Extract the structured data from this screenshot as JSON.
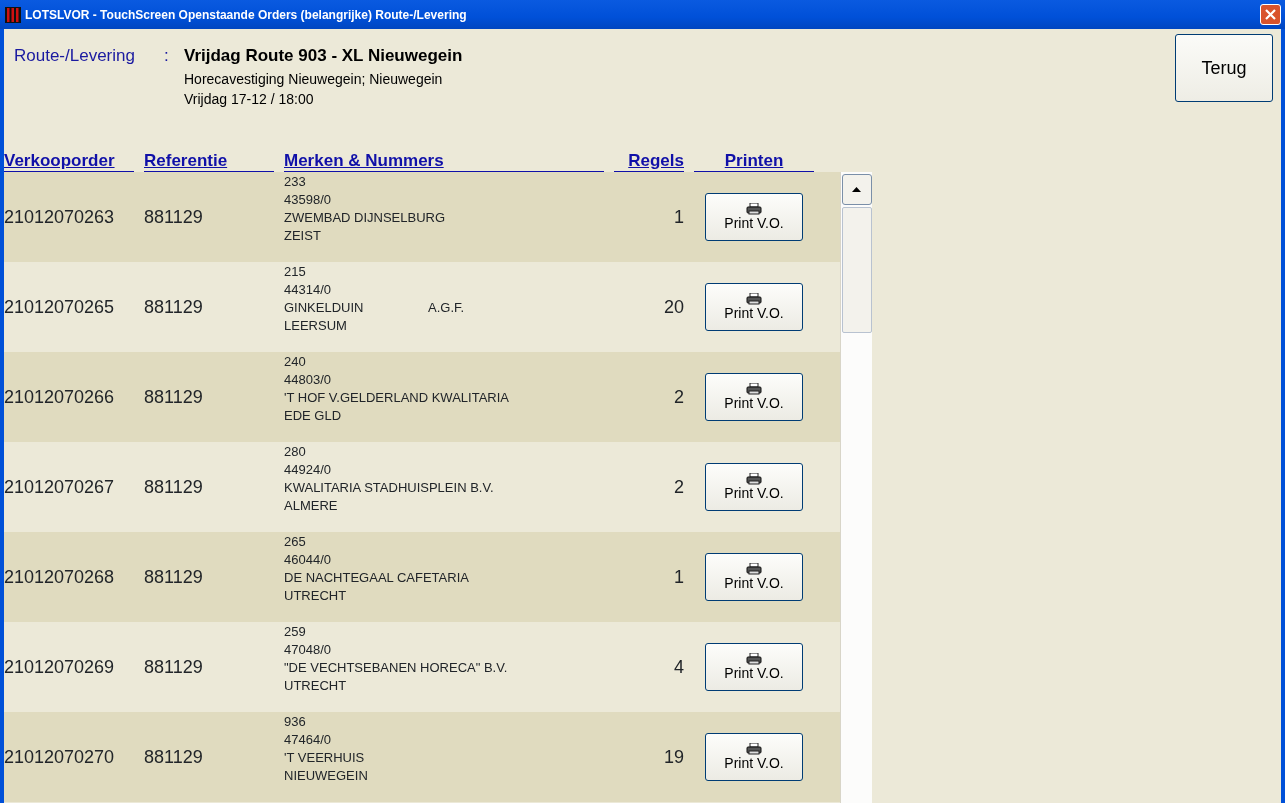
{
  "window": {
    "title": "LOTSLVOR - TouchScreen Openstaande Orders (belangrijke) Route-/Levering"
  },
  "route": {
    "label": "Route-/Levering",
    "separator": ":",
    "name": "Vrijdag Route 903 - XL Nieuwegein",
    "location": "Horecavestiging Nieuwegein; Nieuwegein",
    "time": "Vrijdag 17-12 / 18:00"
  },
  "back_button": "Terug",
  "table": {
    "columns": [
      "Verkooporder",
      "Referentie",
      "Merken & Nummers",
      "Regels",
      "Printen"
    ],
    "rows": [
      {
        "order": "21012070263",
        "reference": "881129",
        "marks": [
          "233",
          "43598/0",
          "ZWEMBAD DIJNSELBURG",
          "ZEIST"
        ],
        "lines": "1",
        "button": "Print V.O."
      },
      {
        "order": "21012070265",
        "reference": "881129",
        "marks": [
          "215",
          "44314/0",
          "GINKELDUIN",
          "LEERSUM"
        ],
        "note": "A.G.F.",
        "lines": "20",
        "button": "Print V.O."
      },
      {
        "order": "21012070266",
        "reference": "881129",
        "marks": [
          "240",
          "44803/0",
          "'T HOF V.GELDERLAND KWALITARIA",
          "EDE GLD"
        ],
        "lines": "2",
        "button": "Print V.O."
      },
      {
        "order": "21012070267",
        "reference": "881129",
        "marks": [
          "280",
          "44924/0",
          "KWALITARIA STADHUISPLEIN B.V.",
          "ALMERE"
        ],
        "lines": "2",
        "button": "Print V.O."
      },
      {
        "order": "21012070268",
        "reference": "881129",
        "marks": [
          "265",
          "46044/0",
          "DE NACHTEGAAL CAFETARIA",
          "UTRECHT"
        ],
        "lines": "1",
        "button": "Print V.O."
      },
      {
        "order": "21012070269",
        "reference": "881129",
        "marks": [
          "259",
          "47048/0",
          "\"DE VECHTSEBANEN HORECA\" B.V.",
          "UTRECHT"
        ],
        "lines": "4",
        "button": "Print V.O."
      },
      {
        "order": "21012070270",
        "reference": "881129",
        "marks": [
          "936",
          "47464/0",
          "'T VEERHUIS",
          "NIEUWEGEIN"
        ],
        "lines": "19",
        "button": "Print V.O."
      }
    ]
  }
}
